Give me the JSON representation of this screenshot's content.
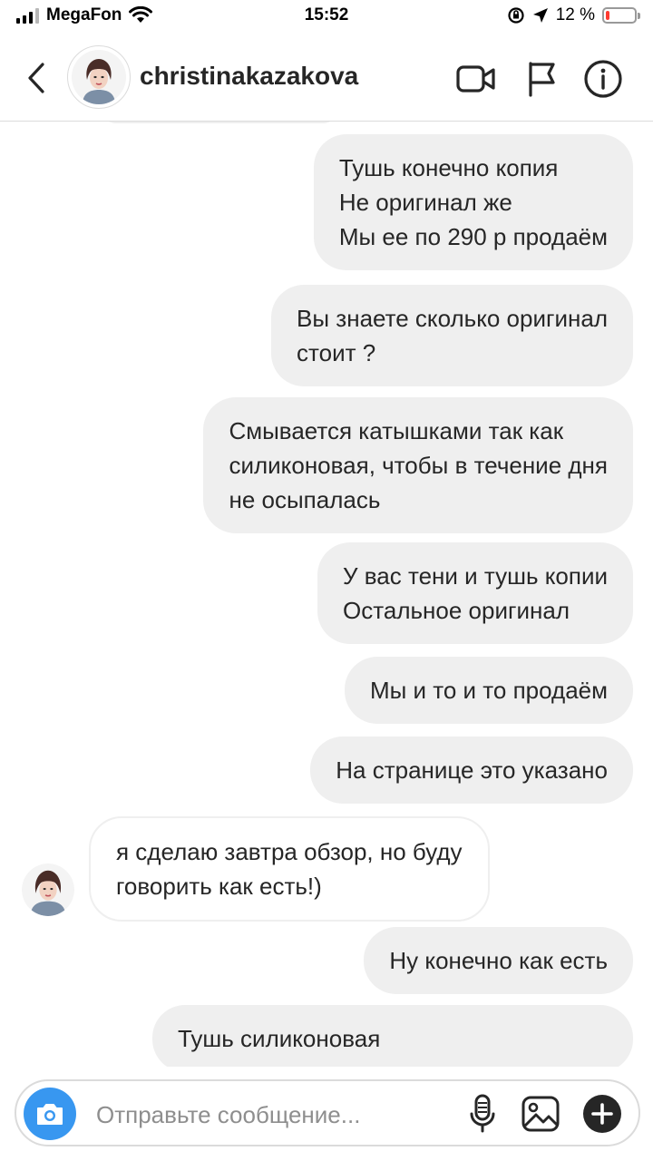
{
  "status_bar": {
    "carrier": "MegaFon",
    "time": "15:52",
    "battery": "12 %",
    "battery_level": 0.12
  },
  "header": {
    "username": "christinakazakova",
    "icons": [
      "back-chevron-icon",
      "video-camera-icon",
      "flag-icon",
      "info-icon"
    ]
  },
  "messages": [
    {
      "sender": "me",
      "lines": [
        "Тушь конечно копия",
        "Не оригинал же",
        "Мы ее по 290 р продаём"
      ]
    },
    {
      "sender": "me",
      "lines": [
        "Вы знаете сколько оригинал",
        "стоит ?"
      ]
    },
    {
      "sender": "me",
      "lines": [
        "Смывается катышками так как",
        "силиконовая, чтобы в течение дня",
        "не осыпалась"
      ]
    },
    {
      "sender": "me",
      "lines": [
        "У вас тени и тушь копии",
        "Остальное оригинал"
      ]
    },
    {
      "sender": "me",
      "lines": [
        "Мы и то и то продаём"
      ]
    },
    {
      "sender": "me",
      "lines": [
        "На странице это указано"
      ]
    },
    {
      "sender": "them",
      "lines": [
        "я сделаю завтра обзор, но буду",
        "говорить как есть!)"
      ]
    },
    {
      "sender": "me",
      "lines": [
        "Ну конечно как есть"
      ]
    },
    {
      "sender": "me",
      "lines": [
        "Тушь силиконовая"
      ]
    }
  ],
  "composer": {
    "placeholder": "Отправьте сообщение...",
    "icons": [
      "camera-icon",
      "microphone-icon",
      "gallery-icon",
      "plus-icon"
    ],
    "camera_color": "#3897f0"
  },
  "colors": {
    "outgoing_bubble": "#efefef",
    "incoming_border": "#efefef",
    "text": "#262626",
    "placeholder": "#8e8e8e"
  }
}
